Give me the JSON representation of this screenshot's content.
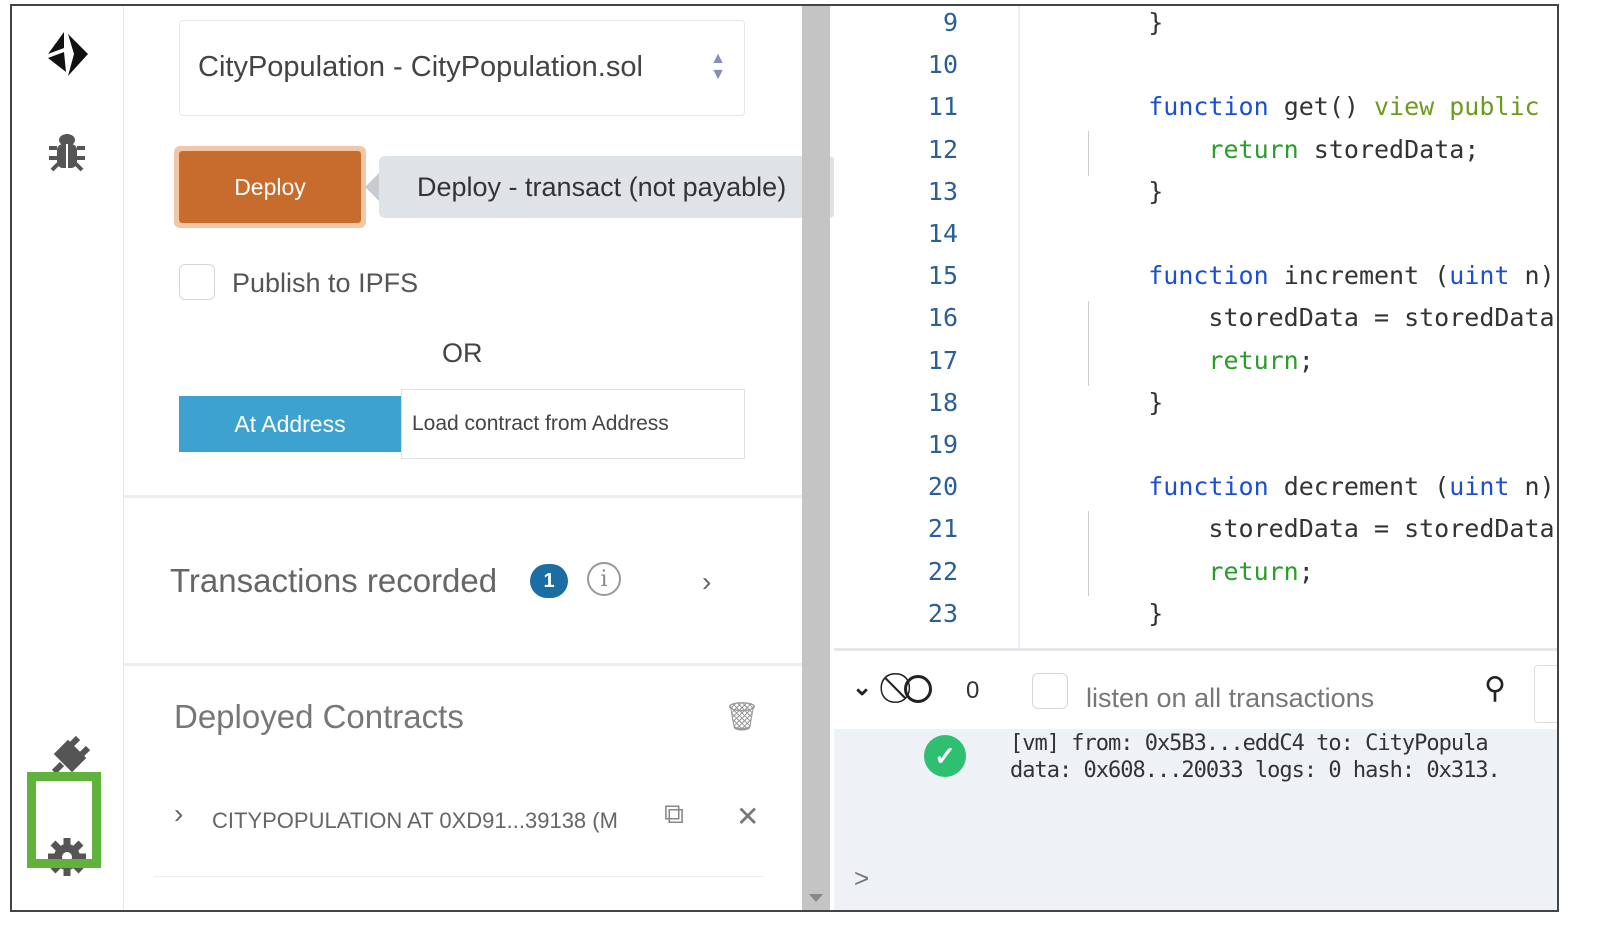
{
  "sidebar_icons": [
    "remix-logo-icon",
    "debugger-bug-icon",
    "plugin-icon",
    "settings-gear-icon"
  ],
  "run_panel": {
    "contract_select": "CityPopulation - CityPopulation.sol",
    "deploy_label": "Deploy",
    "deploy_tooltip": "Deploy - transact (not payable)",
    "publish_ipfs_label": "Publish to IPFS",
    "publish_ipfs_checked": false,
    "or_label": "OR",
    "at_address_label": "At Address",
    "address_placeholder": "Load contract from Address",
    "transactions_recorded_label": "Transactions recorded",
    "transactions_count": "1",
    "deployed_contracts_label": "Deployed Contracts",
    "deployed_instance": "CITYPOPULATION AT 0XD91...39138 (M"
  },
  "editor": {
    "line_numbers": [
      "9",
      "10",
      "11",
      "12",
      "13",
      "14",
      "15",
      "16",
      "17",
      "18",
      "19",
      "20",
      "21",
      "22",
      "23"
    ],
    "lines": [
      [
        [
          "    }",
          ""
        ]
      ],
      [
        [
          "",
          ""
        ]
      ],
      [
        [
          "    ",
          ""
        ],
        [
          "function",
          "kw"
        ],
        [
          " get() ",
          ""
        ],
        [
          "view public r",
          "yg"
        ]
      ],
      [
        [
          "        ",
          ""
        ],
        [
          "return",
          "gr"
        ],
        [
          " storedData;",
          ""
        ]
      ],
      [
        [
          "    }",
          ""
        ]
      ],
      [
        [
          "",
          ""
        ]
      ],
      [
        [
          "    ",
          ""
        ],
        [
          "function",
          "kw"
        ],
        [
          " increment (",
          ""
        ],
        [
          "uint",
          "kw"
        ],
        [
          " n)",
          ""
        ]
      ],
      [
        [
          "        storedData = storedData",
          ""
        ]
      ],
      [
        [
          "        ",
          ""
        ],
        [
          "return",
          "gr"
        ],
        [
          ";",
          ""
        ]
      ],
      [
        [
          "    }",
          ""
        ]
      ],
      [
        [
          "",
          ""
        ]
      ],
      [
        [
          "    ",
          ""
        ],
        [
          "function",
          "kw"
        ],
        [
          " decrement (",
          ""
        ],
        [
          "uint",
          "kw"
        ],
        [
          " n)",
          ""
        ]
      ],
      [
        [
          "        storedData = storedData",
          ""
        ]
      ],
      [
        [
          "        ",
          ""
        ],
        [
          "return",
          "gr"
        ],
        [
          ";",
          ""
        ]
      ],
      [
        [
          "    }",
          ""
        ]
      ]
    ]
  },
  "console": {
    "pending_count": "0",
    "listen_label": "listen on all transactions",
    "listen_checked": false,
    "log_line1": "[vm] from: 0x5B3...eddC4 to: CityPopula",
    "log_line2": "data: 0x608...20033 logs: 0 hash: 0x313.",
    "prompt": ">"
  },
  "colors": {
    "deploy": "#c86c2e",
    "at_address": "#3da2cf",
    "badge": "#1a6ea3",
    "success": "#2fbf71",
    "highlight": "#5fb33a"
  }
}
